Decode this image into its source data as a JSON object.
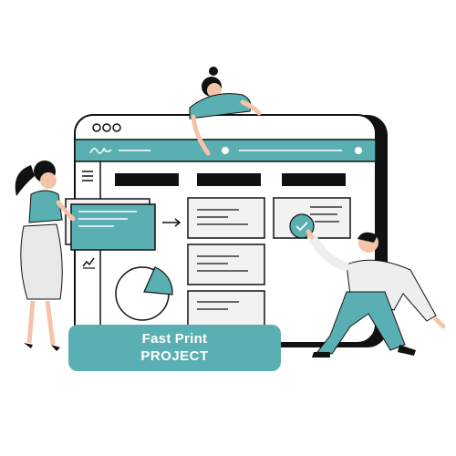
{
  "banner": {
    "line1_word1": "Fast",
    "line1_word2": "Print",
    "line2": "PROJECT"
  },
  "colors": {
    "accent": "#5aafb2",
    "outline": "#111111",
    "skin": "#f5c4a8",
    "paper": "#f2f2f2"
  },
  "icons": [
    "window-dots-icon",
    "signature-icon",
    "menu-icon",
    "chart-line-icon",
    "arrow-right-icon",
    "checkmark-icon",
    "pie-chart-icon"
  ]
}
